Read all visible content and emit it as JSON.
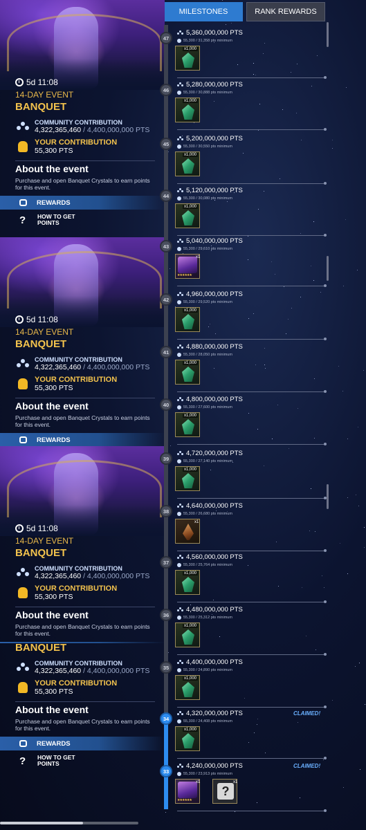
{
  "tabs": {
    "milestones": "MILESTONES",
    "rank_rewards": "RANK REWARDS"
  },
  "panels": [
    {
      "timer": "5d 11:08",
      "event_type": "14-DAY EVENT",
      "event_name": "BANQUET",
      "community_label": "COMMUNITY CONTRIBUTION",
      "community_value": "4,322,365,460",
      "community_target": "/ 4,400,000,000 PTS",
      "your_label": "YOUR CONTRIBUTION",
      "your_value": "55,300 PTS",
      "about_title": "About the event",
      "about_text": "Purchase and open Banquet Crystals to earn points for this event.",
      "rewards_label": "REWARDS",
      "howto_label": "HOW TO GET POINTS"
    },
    {
      "timer": "5d 11:08",
      "event_type": "14-DAY EVENT",
      "event_name": "BANQUET",
      "community_label": "COMMUNITY CONTRIBUTION",
      "community_value": "4,322,365,460",
      "community_target": "/ 4,400,000,000 PTS",
      "your_label": "YOUR CONTRIBUTION",
      "your_value": "55,300 PTS",
      "about_title": "About the event",
      "about_text": "Purchase and open Banquet Crystals to earn points for this event.",
      "rewards_label": "REWARDS",
      "howto_label": "HOW TO GET POINTS"
    },
    {
      "timer": "5d 11:08",
      "event_type": "14-DAY EVENT",
      "event_name": "BANQUET",
      "community_label": "COMMUNITY CONTRIBUTION",
      "community_value": "4,322,365,460",
      "community_target": "/ 4,400,000,000 PTS",
      "your_label": "YOUR CONTRIBUTION",
      "your_value": "55,300 PTS",
      "about_title": "About the event",
      "about_text": "Purchase and open Banquet Crystals to earn points for this event.",
      "rewards_label": "REWARDS",
      "howto_label": "HOW TO GET POINTS"
    },
    {
      "event_name": "BANQUET",
      "community_label": "COMMUNITY CONTRIBUTION",
      "community_value": "4,322,365,460",
      "community_target": "/ 4,400,000,000 PTS",
      "your_label": "YOUR CONTRIBUTION",
      "your_value": "55,300 PTS",
      "about_title": "About the event",
      "about_text": "Purchase and open Banquet Crystals to earn points for this event.",
      "rewards_label": "REWARDS",
      "howto_label": "HOW TO GET POINTS"
    }
  ],
  "milestones": [
    {
      "num": "47",
      "pts": "5,360,000,000 PTS",
      "req": "55,300 / 31,358 pts minimum",
      "reward": "crystal",
      "qty": "x1,000",
      "claimed": ""
    },
    {
      "num": "46",
      "pts": "5,280,000,000 PTS",
      "req": "55,300 / 30,888 pts minimum",
      "reward": "crystal",
      "qty": "x1,000",
      "claimed": ""
    },
    {
      "num": "45",
      "pts": "5,200,000,000 PTS",
      "req": "55,300 / 30,550 pts minimum",
      "reward": "crystal",
      "qty": "x1,000",
      "claimed": ""
    },
    {
      "num": "44",
      "pts": "5,120,000,000 PTS",
      "req": "55,300 / 30,080 pts minimum",
      "reward": "crystal",
      "qty": "x1,000",
      "claimed": ""
    },
    {
      "num": "43",
      "pts": "5,040,000,000 PTS",
      "req": "55,300 / 29,610 pts minimum",
      "reward": "champion",
      "qty": "x1",
      "claimed": ""
    },
    {
      "num": "42",
      "pts": "4,960,000,000 PTS",
      "req": "55,300 / 29,520 pts minimum",
      "reward": "crystal",
      "qty": "x1,000",
      "claimed": ""
    },
    {
      "num": "41",
      "pts": "4,880,000,000 PTS",
      "req": "55,300 / 28,050 pts minimum",
      "reward": "crystal",
      "qty": "x1,000",
      "claimed": ""
    },
    {
      "num": "40",
      "pts": "4,800,000,000 PTS",
      "req": "55,300 / 27,600 pts minimum",
      "reward": "crystal",
      "qty": "x1,000",
      "claimed": ""
    },
    {
      "num": "39",
      "pts": "4,720,000,000 PTS",
      "req": "55,300 / 27,140 pts minimum",
      "reward": "crystal",
      "qty": "x1,000",
      "claimed": ""
    },
    {
      "num": "38",
      "pts": "4,640,000,000 PTS",
      "req": "55,300 / 26,680 pts minimum",
      "reward": "dagger",
      "qty": "x1",
      "claimed": ""
    },
    {
      "num": "37",
      "pts": "4,560,000,000 PTS",
      "req": "55,300 / 25,764 pts minimum",
      "reward": "crystal",
      "qty": "x1,000",
      "claimed": ""
    },
    {
      "num": "36",
      "pts": "4,480,000,000 PTS",
      "req": "55,300 / 25,312 pts minimum",
      "reward": "crystal",
      "qty": "x1,000",
      "claimed": ""
    },
    {
      "num": "35",
      "pts": "4,400,000,000 PTS",
      "req": "55,300 / 24,890 pts minimum",
      "reward": "crystal",
      "qty": "x1,000",
      "claimed": ""
    },
    {
      "num": "34",
      "pts": "4,320,000,000 PTS",
      "req": "55,300 / 24,408 pts minimum",
      "reward": "crystal",
      "qty": "x1,000",
      "claimed": "CLAIMED!"
    },
    {
      "num": "33",
      "pts": "4,240,000,000 PTS",
      "req": "55,300 / 23,913 pts minimum",
      "reward": "champion-mystery",
      "qty": "x1",
      "claimed": "CLAIMED!",
      "qty2": "x1"
    }
  ],
  "icons": {
    "timer": "clock-icon",
    "community": "crowd-icon",
    "your": "bulb-icon",
    "rewards": "gift-icon",
    "howto": "question-icon"
  },
  "colors": {
    "accent": "#2e7bd0",
    "gold": "#f2c24d",
    "claimed": "#6ab0ff"
  }
}
